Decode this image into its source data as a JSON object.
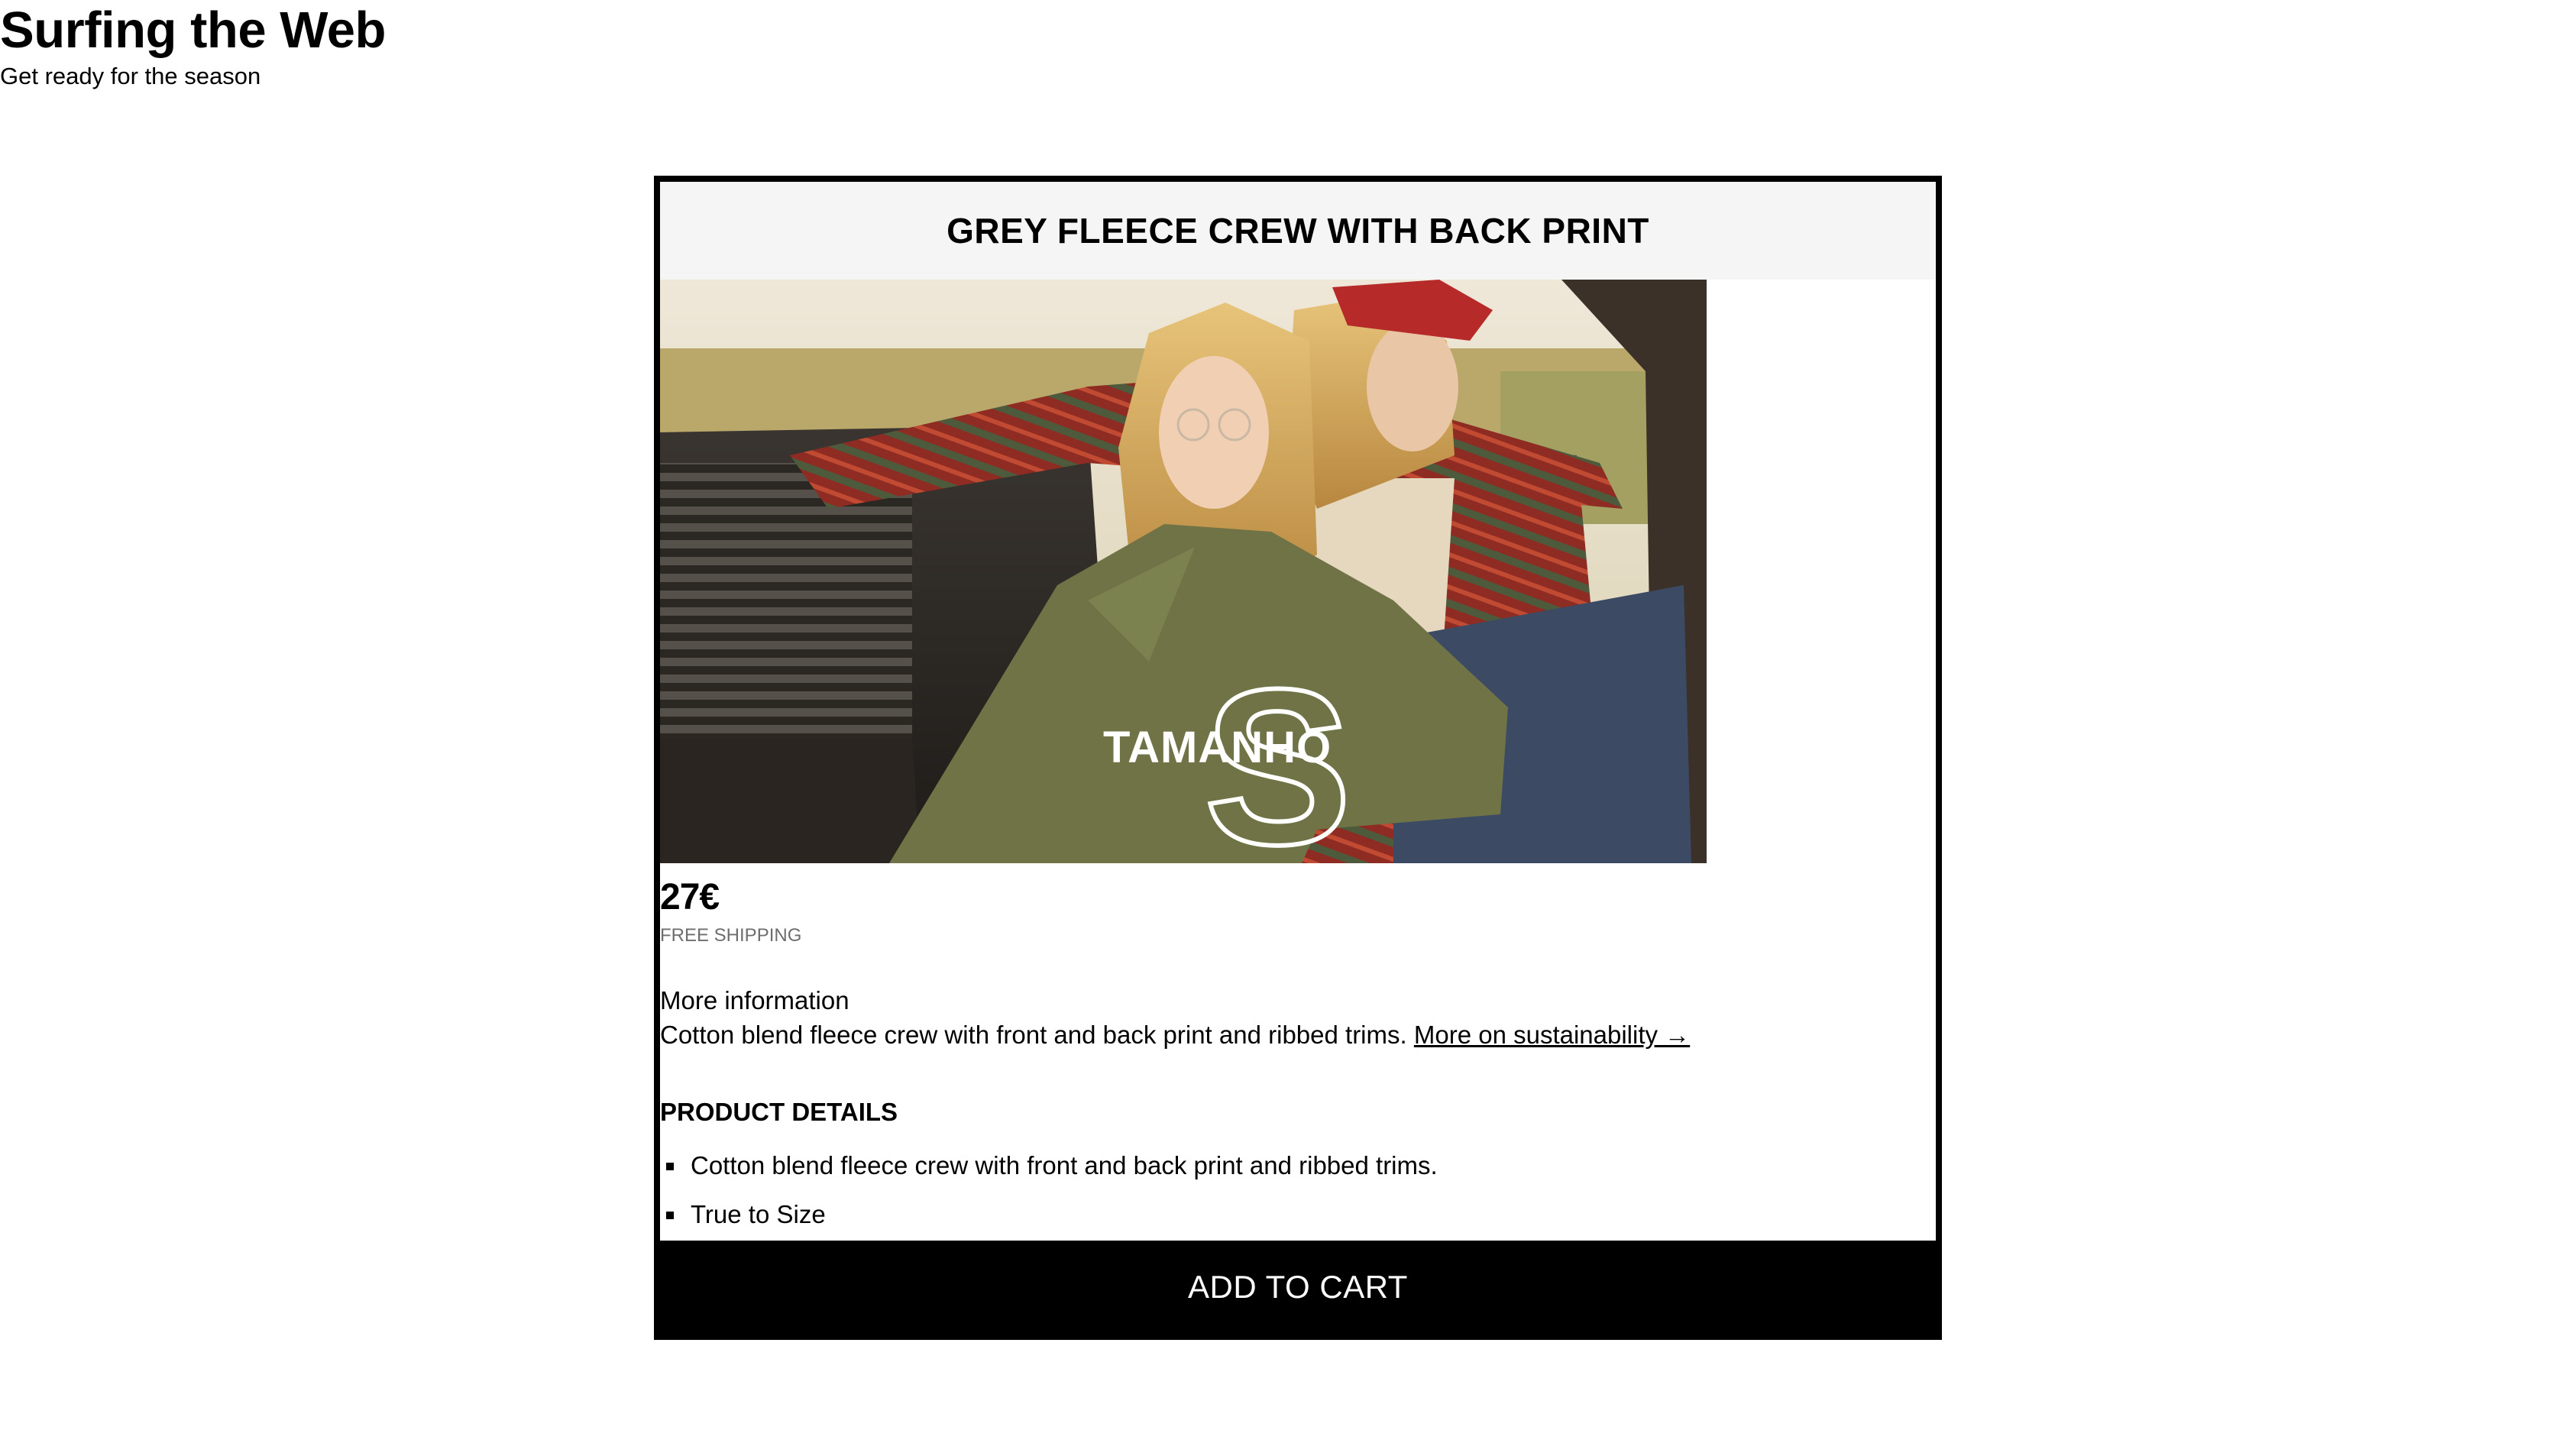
{
  "header": {
    "title": "Surfing the Web",
    "subtitle": "Get ready for the season"
  },
  "product": {
    "title": "GREY FLEECE CREW WITH BACK PRINT",
    "image_overlay_text": "TAMANHO",
    "image_overlay_letter": "S",
    "price": "27€",
    "shipping": "FREE SHIPPING",
    "more_info_label": "More information",
    "description": "Cotton blend fleece crew with front and back print and ribbed trims.",
    "sustainability_link": "More on sustainability →",
    "details_title": "PRODUCT DETAILS",
    "details": [
      "Cotton blend fleece crew with front and back print and ribbed trims.",
      "True to Size"
    ],
    "add_to_cart_label": "ADD TO CART"
  }
}
